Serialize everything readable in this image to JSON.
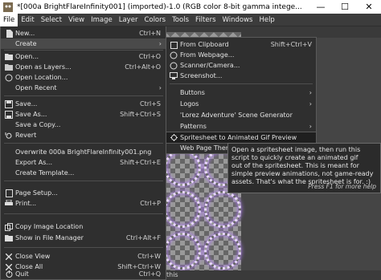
{
  "window": {
    "title": "*[000a BrightFlareInfinity001] (imported)-1.0 (RGB color 8-bit gamma intege...",
    "minimize_glyph": "—",
    "maximize_glyph": "☐",
    "close_glyph": "✕"
  },
  "menubar": [
    "File",
    "Edit",
    "Select",
    "View",
    "Image",
    "Layer",
    "Colors",
    "Tools",
    "Filters",
    "Windows",
    "Help"
  ],
  "file_menu": [
    {
      "label": "New...",
      "shortcut": "Ctrl+N",
      "icon": "new-file-icon"
    },
    {
      "label": "Create",
      "shortcut": "",
      "arrow": "›",
      "icon": "",
      "highlighted": true
    },
    {
      "label": "Open...",
      "shortcut": "Ctrl+O",
      "icon": "open-icon"
    },
    {
      "label": "Open as Layers...",
      "shortcut": "Ctrl+Alt+O",
      "icon": "open-layers-icon"
    },
    {
      "label": "Open Location...",
      "shortcut": "",
      "icon": "location-icon"
    },
    {
      "label": "Open Recent",
      "shortcut": "",
      "arrow": "›",
      "icon": ""
    },
    {
      "label": "Save...",
      "shortcut": "Ctrl+S",
      "icon": "save-icon"
    },
    {
      "label": "Save As...",
      "shortcut": "Shift+Ctrl+S",
      "icon": "save-as-icon"
    },
    {
      "label": "Save a Copy...",
      "shortcut": "",
      "icon": ""
    },
    {
      "label": "Revert",
      "shortcut": "",
      "icon": "revert-icon"
    },
    {
      "label": "Overwrite 000a BrightFlareInfinity001.png",
      "shortcut": "",
      "icon": ""
    },
    {
      "label": "Export As...",
      "shortcut": "Shift+Ctrl+E",
      "icon": ""
    },
    {
      "label": "Create Template...",
      "shortcut": "",
      "icon": ""
    },
    {
      "label": "Page Setup...",
      "shortcut": "",
      "icon": "page-setup-icon"
    },
    {
      "label": "Print...",
      "shortcut": "Ctrl+P",
      "icon": "print-icon"
    },
    {
      "label": "Copy Image Location",
      "shortcut": "",
      "icon": "copy-location-icon"
    },
    {
      "label": "Show in File Manager",
      "shortcut": "Ctrl+Alt+F",
      "icon": "file-manager-icon"
    },
    {
      "label": "Close View",
      "shortcut": "Ctrl+W",
      "icon": "close-view-icon"
    },
    {
      "label": "Close All",
      "shortcut": "Shift+Ctrl+W",
      "icon": "close-all-icon"
    },
    {
      "label": "Quit",
      "shortcut": "Ctrl+Q",
      "icon": "quit-icon"
    }
  ],
  "create_menu": [
    {
      "label": "From Clipboard",
      "shortcut": "Shift+Ctrl+V",
      "icon": "clipboard-icon"
    },
    {
      "label": "From Webpage...",
      "shortcut": "",
      "icon": "webpage-icon"
    },
    {
      "label": "Scanner/Camera...",
      "shortcut": "",
      "icon": "scanner-icon"
    },
    {
      "label": "Screenshot...",
      "shortcut": "",
      "icon": "screenshot-icon"
    },
    {
      "label": "Buttons",
      "shortcut": "",
      "arrow": "›"
    },
    {
      "label": "Logos",
      "shortcut": "",
      "arrow": "›"
    },
    {
      "label": "'Lorez Adventure' Scene Generator",
      "shortcut": ""
    },
    {
      "label": "Patterns",
      "shortcut": "",
      "arrow": "›"
    },
    {
      "label": "Spritesheet to Animated Gif Preview",
      "shortcut": "",
      "icon": "script-icon",
      "highlighted": true
    },
    {
      "label": "Web Page Themes",
      "shortcut": "",
      "arrow": "›"
    }
  ],
  "tooltip": {
    "text": "Open a spritesheet image, then run this\nscript to quickly create an animated gif\nout of the spritesheet. This is meant for\nsimple preview animations, not game-ready\nassets. That's what the spritesheet is for. :)",
    "hint": "Press F1 for more help"
  },
  "status": {
    "text": "this"
  },
  "colors": {
    "menu_bg": "#2f2f2f",
    "canvas_bg": "#454545",
    "glow": "#b47cff"
  }
}
